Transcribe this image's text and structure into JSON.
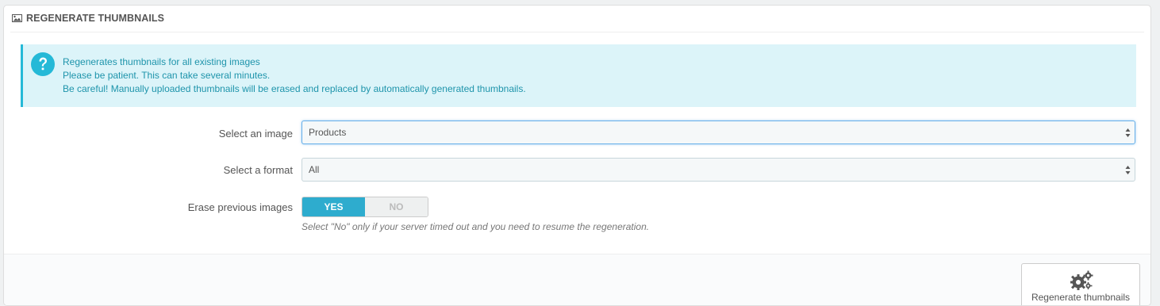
{
  "panel": {
    "title": "Regenerate thumbnails",
    "title_icon": "image-icon"
  },
  "alert": {
    "icon": "question-circle-icon",
    "lines": [
      "Regenerates thumbnails for all existing images",
      "Please be patient. This can take several minutes.",
      "Be careful! Manually uploaded thumbnails will be erased and replaced by automatically generated thumbnails."
    ],
    "color": "#1e94ab",
    "background": "#dcf4f9",
    "border": "#25b9d7"
  },
  "form": {
    "image": {
      "label": "Select an image",
      "value": "Products"
    },
    "format": {
      "label": "Select a format",
      "value": "All"
    },
    "erase": {
      "label": "Erase previous images",
      "yes": "YES",
      "no": "NO",
      "selected": "YES",
      "help": "Select \"No\" only if your server timed out and you need to resume the regeneration."
    }
  },
  "footer": {
    "button_label": "Regenerate thumbnails",
    "button_icon": "gears-icon"
  },
  "colors": {
    "accent": "#2eacce"
  }
}
